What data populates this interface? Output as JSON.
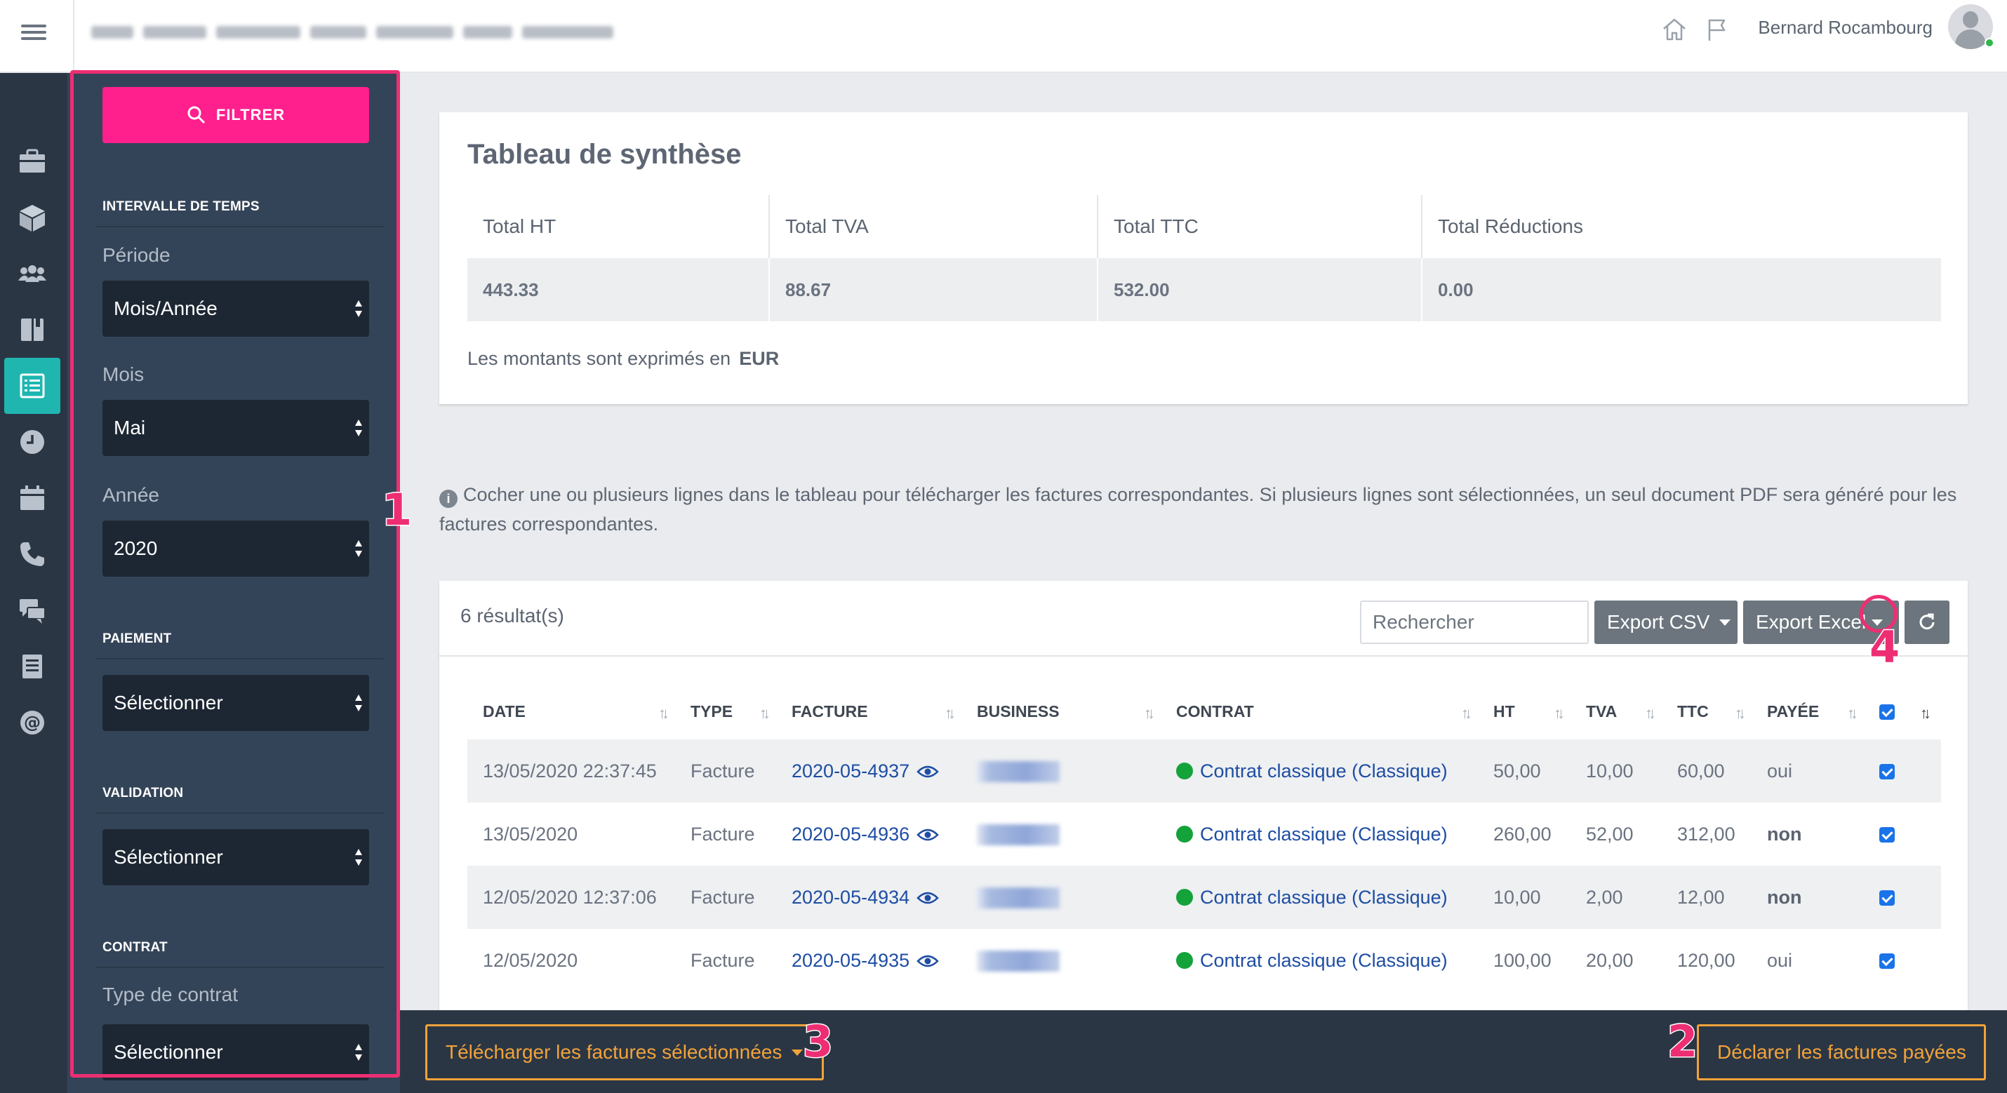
{
  "topbar": {
    "user_name": "Bernard Rocambourg"
  },
  "filter": {
    "button_label": "FILTRER",
    "sections": {
      "time_interval": "INTERVALLE DE TEMPS",
      "payment": "PAIEMENT",
      "validation": "VALIDATION",
      "contract": "CONTRAT"
    },
    "periode_label": "Période",
    "periode_value": "Mois/Année",
    "mois_label": "Mois",
    "mois_value": "Mai",
    "annee_label": "Année",
    "annee_value": "2020",
    "paiement_value": "Sélectionner",
    "validation_value": "Sélectionner",
    "type_contrat_label": "Type de contrat",
    "type_contrat_value": "Sélectionner"
  },
  "annotations": {
    "n1": "1",
    "n2": "2",
    "n3": "3",
    "n4": "4"
  },
  "summary": {
    "title": "Tableau de synthèse",
    "headers": [
      "Total HT",
      "Total TVA",
      "Total TTC",
      "Total Réductions"
    ],
    "values": [
      "443.33",
      "88.67",
      "532.00",
      "0.00"
    ],
    "note": "Les montants sont exprimés en",
    "currency": "EUR"
  },
  "info_note": "Cocher une ou plusieurs lignes dans le tableau pour télécharger les factures correspondantes. Si plusieurs lignes sont sélectionnées, un seul document PDF sera généré pour les factures correspondantes.",
  "results": {
    "count": "6 résultat(s)",
    "search_placeholder": "Rechercher",
    "export_csv": "Export CSV",
    "export_excel": "Export Excel",
    "columns": [
      "DATE",
      "TYPE",
      "FACTURE",
      "BUSINESS",
      "CONTRAT",
      "HT",
      "TVA",
      "TTC",
      "PAYÉE"
    ],
    "rows": [
      {
        "date": "13/05/2020 22:37:45",
        "type": "Facture",
        "facture": "2020-05-4937",
        "contrat": "Contrat classique (Classique)",
        "ht": "50,00",
        "tva": "10,00",
        "ttc": "60,00",
        "payee": "oui"
      },
      {
        "date": "13/05/2020",
        "type": "Facture",
        "facture": "2020-05-4936",
        "contrat": "Contrat classique (Classique)",
        "ht": "260,00",
        "tva": "52,00",
        "ttc": "312,00",
        "payee": "non"
      },
      {
        "date": "12/05/2020 12:37:06",
        "type": "Facture",
        "facture": "2020-05-4934",
        "contrat": "Contrat classique (Classique)",
        "ht": "10,00",
        "tva": "2,00",
        "ttc": "12,00",
        "payee": "non"
      },
      {
        "date": "12/05/2020",
        "type": "Facture",
        "facture": "2020-05-4935",
        "contrat": "Contrat classique (Classique)",
        "ht": "100,00",
        "tva": "20,00",
        "ttc": "120,00",
        "payee": "oui"
      }
    ]
  },
  "bottombar": {
    "download_label": "Télécharger les factures sélectionnées",
    "declare_label": "Déclarer les factures payées"
  },
  "colors": {
    "accent_pink": "#ff1f8d",
    "annotation": "#ee2e73",
    "orange": "#f2a33a",
    "teal_active": "#1fb6b0",
    "link_blue": "#1e4da3",
    "status_green": "#14a33a"
  }
}
